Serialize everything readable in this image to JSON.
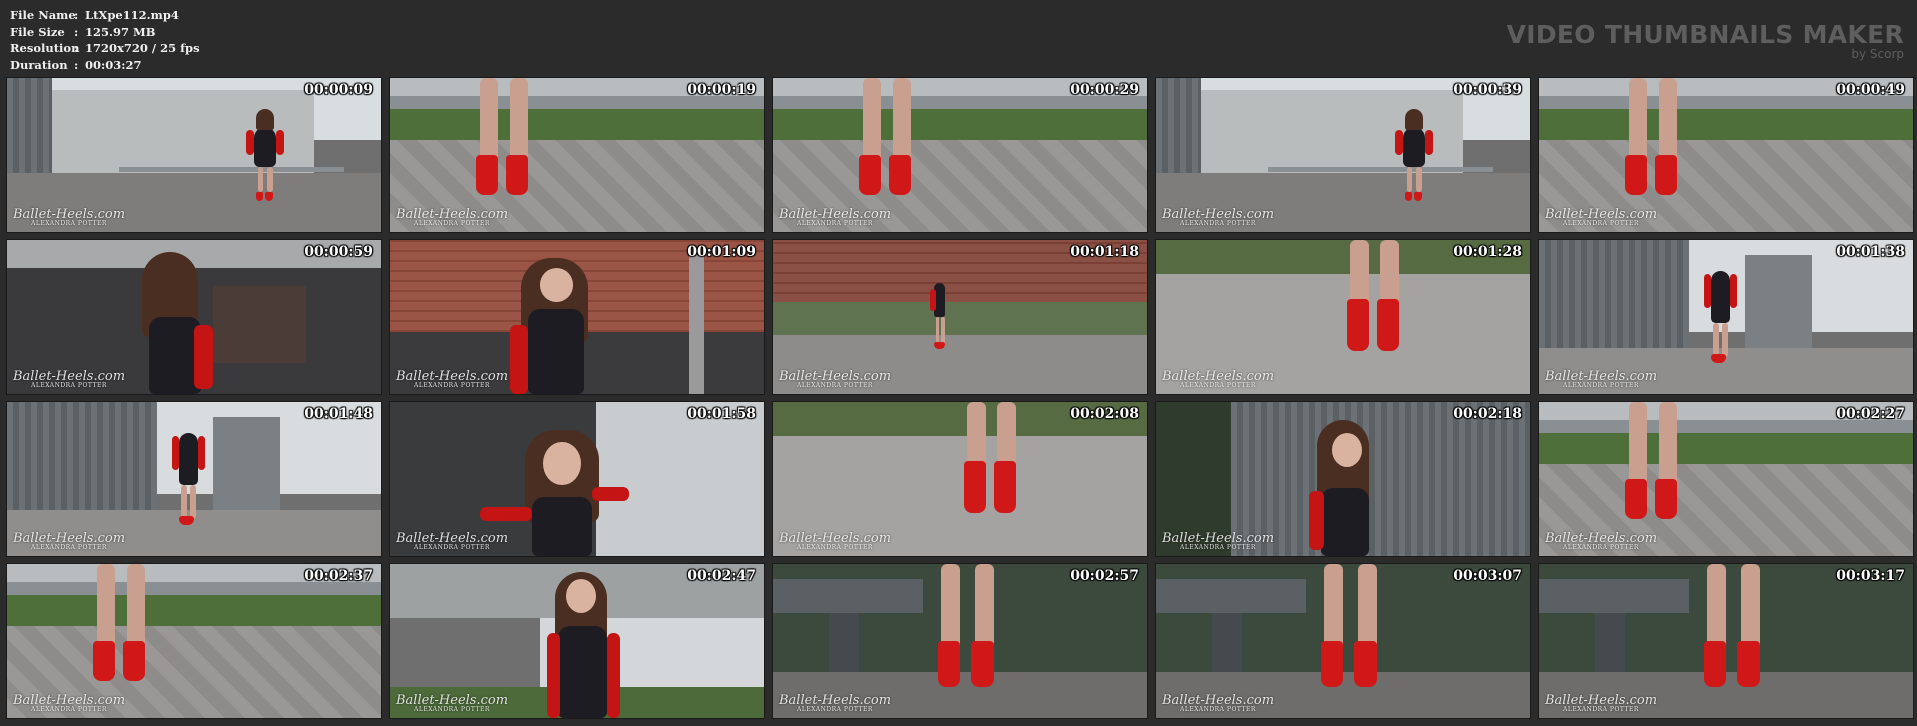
{
  "header": {
    "fields": [
      {
        "key": "File Name",
        "value": "LtXpe112.mp4"
      },
      {
        "key": "File Size",
        "value": "125.97 MB"
      },
      {
        "key": "Resolution",
        "value": "1720x720 / 25 fps"
      },
      {
        "key": "Duration",
        "value": "00:03:27"
      }
    ],
    "separator": ":",
    "brand_title": "VIDEO THUMBNAILS MAKER",
    "brand_sub": "by Scorp"
  },
  "watermark": {
    "main": "Ballet-Heels.com",
    "sub": "ALEXANDRA POTTER"
  },
  "thumbnails": [
    {
      "time": "00:00:09",
      "scene": "industrial-walk"
    },
    {
      "time": "00:00:19",
      "scene": "legs-rail"
    },
    {
      "time": "00:00:29",
      "scene": "legs-rail"
    },
    {
      "time": "00:00:39",
      "scene": "industrial-walk"
    },
    {
      "time": "00:00:49",
      "scene": "legs-rail"
    },
    {
      "time": "00:00:59",
      "scene": "portrait-side"
    },
    {
      "time": "00:01:09",
      "scene": "portrait-brick"
    },
    {
      "time": "00:01:18",
      "scene": "brick-wide"
    },
    {
      "time": "00:01:28",
      "scene": "legs-ground"
    },
    {
      "time": "00:01:38",
      "scene": "silo-walk"
    },
    {
      "time": "00:01:48",
      "scene": "silo-walk"
    },
    {
      "time": "00:01:58",
      "scene": "portrait-wide"
    },
    {
      "time": "00:02:08",
      "scene": "legs-ground"
    },
    {
      "time": "00:02:18",
      "scene": "portrait-metal"
    },
    {
      "time": "00:02:27",
      "scene": "legs-rail"
    },
    {
      "time": "00:02:37",
      "scene": "legs-rail"
    },
    {
      "time": "00:02:47",
      "scene": "portrait-building"
    },
    {
      "time": "00:02:57",
      "scene": "legs-dark"
    },
    {
      "time": "00:03:07",
      "scene": "legs-dark"
    },
    {
      "time": "00:03:17",
      "scene": "legs-dark"
    }
  ],
  "colors": {
    "background": "#2b2b2b",
    "accent_red": "#d01818",
    "brand_gray": "#5e5e5e"
  }
}
